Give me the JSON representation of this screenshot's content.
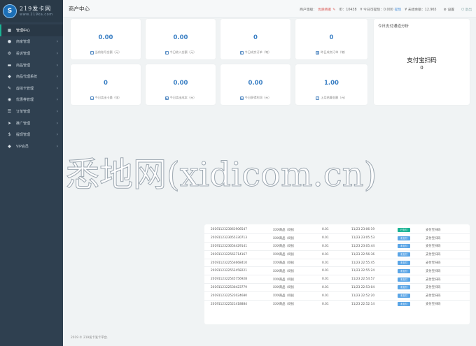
{
  "sidebar": {
    "logo_mark": "S",
    "logo_title": "219发卡网",
    "logo_sub": "www.219ka.com",
    "items": [
      {
        "label": "管理中心",
        "icon": "grid-icon",
        "glyph": "▦",
        "active": true,
        "arrow": false
      },
      {
        "label": "商家管理",
        "icon": "user-icon",
        "glyph": "●",
        "active": false,
        "arrow": true
      },
      {
        "label": "投诉管理",
        "icon": "gear-icon",
        "glyph": "⚙",
        "active": false,
        "arrow": true
      },
      {
        "label": "商品管理",
        "icon": "folder-icon",
        "glyph": "▬",
        "active": false,
        "arrow": true
      },
      {
        "label": "商品代理系统",
        "icon": "tag-icon",
        "glyph": "◆",
        "active": false,
        "arrow": true
      },
      {
        "label": "虚拟卡管理",
        "icon": "pencil-icon",
        "glyph": "✎",
        "active": false,
        "arrow": true
      },
      {
        "label": "优惠券管理",
        "icon": "coupon-icon",
        "glyph": "◉",
        "active": false,
        "arrow": true
      },
      {
        "label": "订单管理",
        "icon": "list-icon",
        "glyph": "☰",
        "active": false,
        "arrow": true
      },
      {
        "label": "推广管理",
        "icon": "send-icon",
        "glyph": "➤",
        "active": false,
        "arrow": true
      },
      {
        "label": "提现管理",
        "icon": "dollar-icon",
        "glyph": "$",
        "active": false,
        "arrow": true
      },
      {
        "label": "VIP会员",
        "icon": "tag-icon",
        "glyph": "◆",
        "active": false,
        "arrow": true
      }
    ]
  },
  "topbar": {
    "title": "商户中心",
    "level_label": "商户等级：",
    "level_value": "优质商家",
    "id_text": "ID：10438",
    "withdraw_text": "¥ 今日可提现：0.000",
    "withdraw_link": "提现",
    "balance_text": "¥ 未结余额：12.965",
    "settings": "设置",
    "logout": "退出"
  },
  "stats": [
    {
      "value": "0.00",
      "label": "当前账号金额（元）",
      "icon": "wallet-icon"
    },
    {
      "value": "0.00",
      "label": "今日收入金额（元）",
      "icon": "coin-icon"
    },
    {
      "value": "0",
      "label": "今日成交订单（笔）",
      "icon": "cart-icon"
    },
    {
      "value": "0",
      "label": "昨日成交订单（笔）",
      "icon": "calendar-icon"
    },
    {
      "value": "0",
      "label": "今日卖出卡量（张）",
      "icon": "card-icon"
    },
    {
      "value": "0.00",
      "label": "今日卖出成本（元）",
      "icon": "box-icon"
    },
    {
      "value": "0.00",
      "label": "今日获得利润（元）",
      "icon": "chart-icon"
    },
    {
      "value": "1.00",
      "label": "上月结算金额（元）",
      "icon": "bag-icon"
    }
  ],
  "analysis": {
    "title": "今日支付通道分析",
    "channel": "支付宝扫码",
    "value": "0"
  },
  "watermark": "悉地网(xidicom.cn)",
  "orders": [
    {
      "id": "2019112323061906547",
      "goods": "XXX商品（0张）",
      "amount": "0.01",
      "time": "11/23 23:06:19",
      "status": "已支付",
      "paid": true,
      "channel": "支付宝扫码"
    },
    {
      "id": "2019112323055330713",
      "goods": "XXX商品（0张）",
      "amount": "0.01",
      "time": "11/23 23:05:53",
      "status": "未支付",
      "paid": false,
      "channel": "支付宝扫码"
    },
    {
      "id": "2019112323054429141",
      "goods": "XXX商品（0张）",
      "amount": "0.01",
      "time": "11/23 23:05:44",
      "status": "未支付",
      "paid": false,
      "channel": "支付宝扫码"
    },
    {
      "id": "2019112322563714167",
      "goods": "XXX商品（0张）",
      "amount": "0.01",
      "time": "11/23 22:56:36",
      "status": "未支付",
      "paid": false,
      "channel": "支付宝扫码"
    },
    {
      "id": "2019112322554668410",
      "goods": "XXX商品（0张）",
      "amount": "0.01",
      "time": "11/23 22:55:45",
      "status": "未支付",
      "paid": false,
      "channel": "支付宝扫码"
    },
    {
      "id": "2019112322552458221",
      "goods": "XXX商品（0张）",
      "amount": "0.01",
      "time": "11/23 22:55:24",
      "status": "未支付",
      "paid": false,
      "channel": "支付宝扫码"
    },
    {
      "id": "2019112322545756928",
      "goods": "XXX商品（0张）",
      "amount": "0.01",
      "time": "11/23 22:54:57",
      "status": "未支付",
      "paid": false,
      "channel": "支付宝扫码"
    },
    {
      "id": "2019112322530423779",
      "goods": "XXX商品（0张）",
      "amount": "0.01",
      "time": "11/23 22:53:04",
      "status": "未支付",
      "paid": false,
      "channel": "支付宝扫码"
    },
    {
      "id": "2019112322522024680",
      "goods": "XXX商品（0张）",
      "amount": "0.01",
      "time": "11/23 22:52:20",
      "status": "未支付",
      "paid": false,
      "channel": "支付宝扫码"
    },
    {
      "id": "2019112322521418884",
      "goods": "XXX商品（0张）",
      "amount": "0.01",
      "time": "11/23 22:52:14",
      "status": "未支付",
      "paid": false,
      "channel": "支付宝扫码"
    }
  ],
  "footer": "2019 © 219发卡发卡平台."
}
